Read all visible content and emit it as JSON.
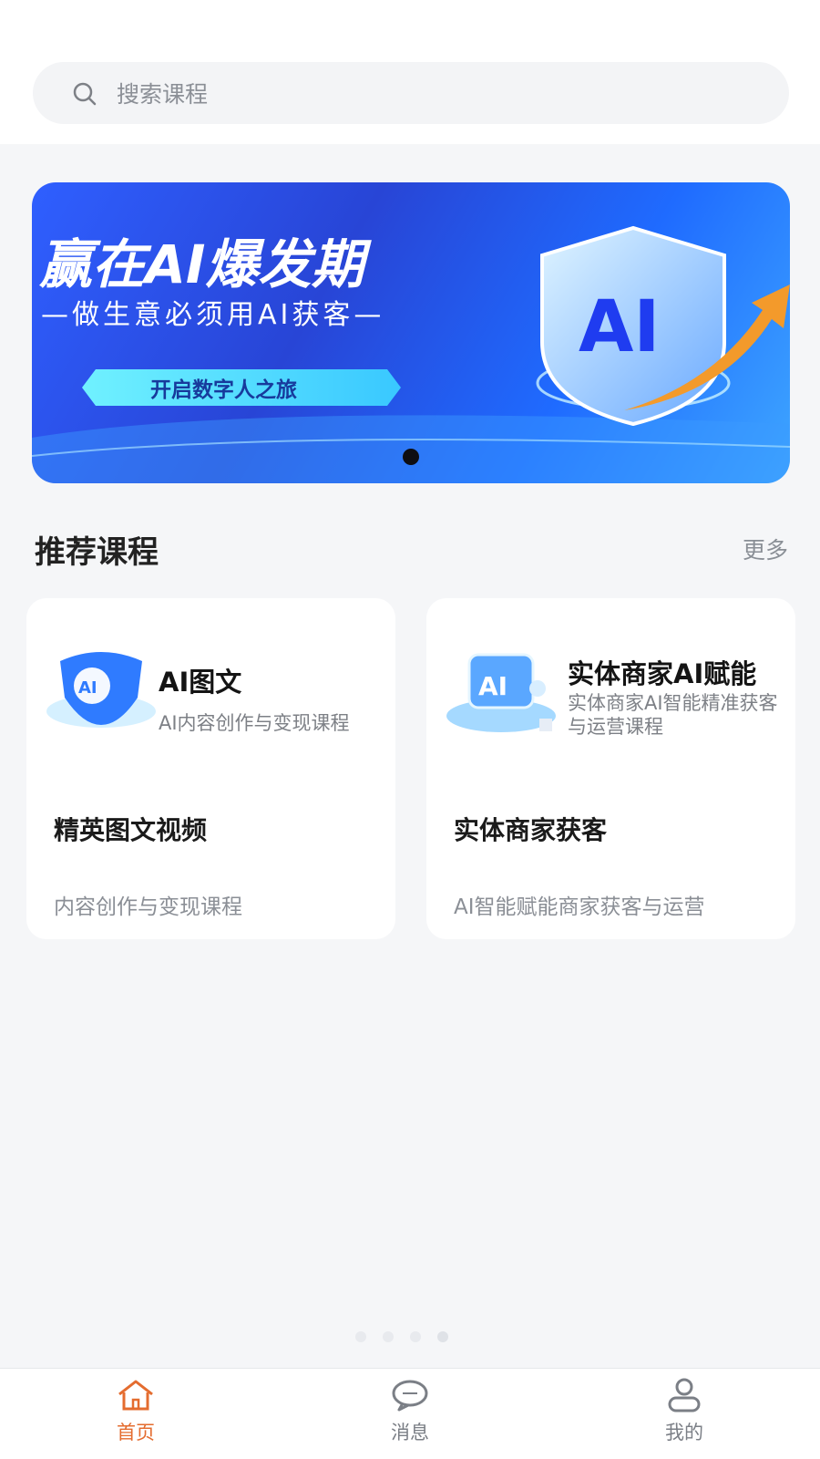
{
  "search": {
    "placeholder": "搜索课程"
  },
  "banner": {
    "headline": "赢在AI爆发期",
    "subheadline": "—做生意必须用AI获客—",
    "cta": "开启数字人之旅",
    "badge_text": "AI",
    "colors": {
      "bg_start": "#2f5fff",
      "bg_end": "#3ea6ff",
      "cta_bg": "#62e0ff",
      "arrow": "#f39a2b"
    }
  },
  "section": {
    "title": "推荐课程",
    "more": "更多"
  },
  "courses": [
    {
      "title": "AI图文",
      "subtitle": "AI内容创作与变现课程",
      "heading": "精英图文视频",
      "desc": "内容创作与变现课程",
      "icon": "ai-shield-icon"
    },
    {
      "title": "实体商家AI赋能",
      "subtitle": "实体商家AI智能精准获客与运营课程",
      "heading": "实体商家获客",
      "desc": "AI智能赋能商家获客与运营",
      "icon": "ai-box-icon"
    }
  ],
  "tabbar": {
    "items": [
      {
        "label": "首页",
        "icon": "home-icon",
        "active": true
      },
      {
        "label": "消息",
        "icon": "chat-icon",
        "active": false
      },
      {
        "label": "我的",
        "icon": "user-icon",
        "active": false
      }
    ],
    "active_color": "#e46c2f"
  }
}
